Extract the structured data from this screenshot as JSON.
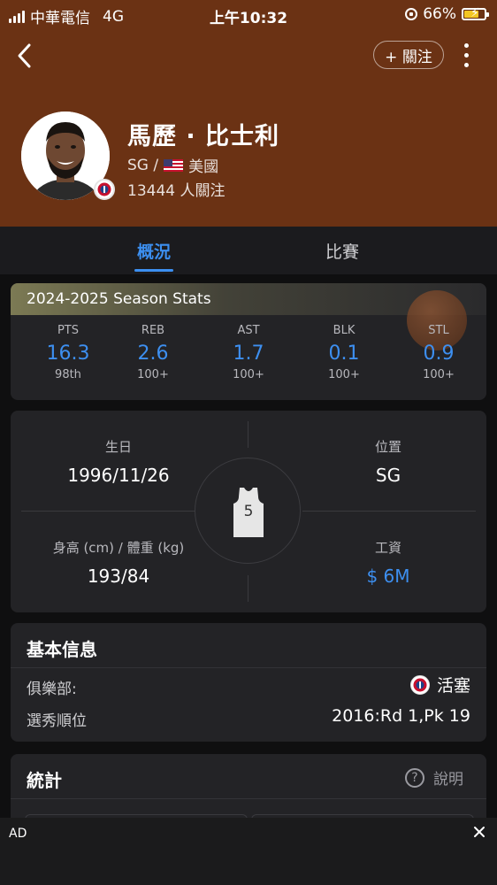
{
  "status_bar": {
    "carrier": "中華電信",
    "network": "4G",
    "time": "上午10:32",
    "battery": "66%",
    "battery_level": 0.66
  },
  "header": {
    "follow_label": "+ 關注",
    "player_name": "馬歷 · 比士利",
    "position": "SG /",
    "country": "美國",
    "followers": "13444 人關注",
    "bg_color": "#6b3214"
  },
  "tabs": [
    {
      "label": "概況",
      "active": true
    },
    {
      "label": "比賽",
      "active": false
    }
  ],
  "season_stats": {
    "title": "2024-2025 Season Stats",
    "stats": [
      {
        "label": "PTS",
        "value": "16.3",
        "rank": "98th"
      },
      {
        "label": "REB",
        "value": "2.6",
        "rank": "100+"
      },
      {
        "label": "AST",
        "value": "1.7",
        "rank": "100+"
      },
      {
        "label": "BLK",
        "value": "0.1",
        "rank": "100+"
      },
      {
        "label": "STL",
        "value": "0.9",
        "rank": "100+"
      }
    ]
  },
  "bio": {
    "birthday_label": "生日",
    "birthday": "1996/11/26",
    "position_label": "位置",
    "position": "SG",
    "height_weight_label": "身高 (cm) / 體重 (kg)",
    "height_weight": "193/84",
    "salary_label": "工資",
    "salary": "$ 6M",
    "jersey_number": "5"
  },
  "basic_info": {
    "title": "基本信息",
    "club_label": "俱樂部:",
    "club": "活塞",
    "draft_label": "選秀順位",
    "draft": "2016:Rd 1,Pk 19"
  },
  "statistics": {
    "title": "統計",
    "help_label": "說明"
  },
  "ad": {
    "label": "AD"
  },
  "colors": {
    "accent": "#3d8ff0",
    "card_bg": "#232326",
    "page_bg": "#0f0f10"
  }
}
